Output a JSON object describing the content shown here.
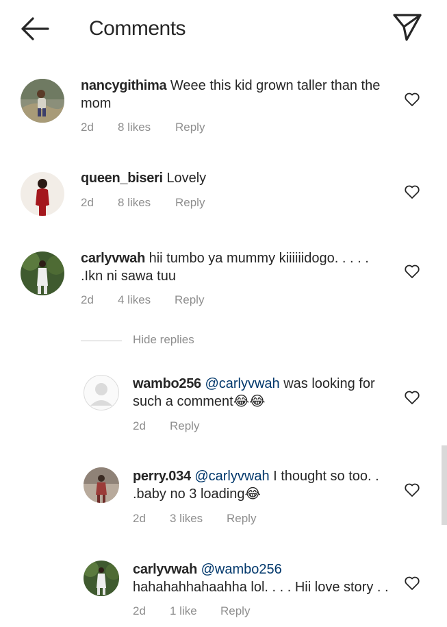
{
  "header": {
    "title": "Comments"
  },
  "comments": [
    {
      "username": "nancygithima",
      "text": "Weee this kid grown taller than the mom",
      "time": "2d",
      "likes": "8 likes",
      "reply": "Reply"
    },
    {
      "username": "queen_biseri",
      "text": "Lovely",
      "time": "2d",
      "likes": "8 likes",
      "reply": "Reply"
    },
    {
      "username": "carlyvwah",
      "text": "hii tumbo ya mummy kiiiiiidogo. . . . . .Ikn ni sawa tuu",
      "time": "2d",
      "likes": "4 likes",
      "reply": "Reply"
    }
  ],
  "hide_replies": "Hide replies",
  "replies": [
    {
      "username": "wambo256",
      "mention": "@carlyvwah",
      "text": " was looking for such a comment😂😂",
      "time": "2d",
      "reply": "Reply"
    },
    {
      "username": "perry.034",
      "mention": "@carlyvwah",
      "text": " I thought so too. . .baby no 3 loading😂",
      "time": "2d",
      "likes": "3 likes",
      "reply": "Reply"
    },
    {
      "username": "carlyvwah",
      "mention": "@wambo256",
      "text": " hahahahhahaahha lol. . . . Hii love story . .",
      "time": "2d",
      "likes": "1 like",
      "reply": "Reply"
    }
  ],
  "icons": {
    "back": "arrow-left-icon",
    "send": "paper-plane-icon",
    "like": "heart-outline-icon"
  },
  "colors": {
    "text": "#262626",
    "secondary": "#8e8e8e",
    "mention": "#00376b"
  }
}
